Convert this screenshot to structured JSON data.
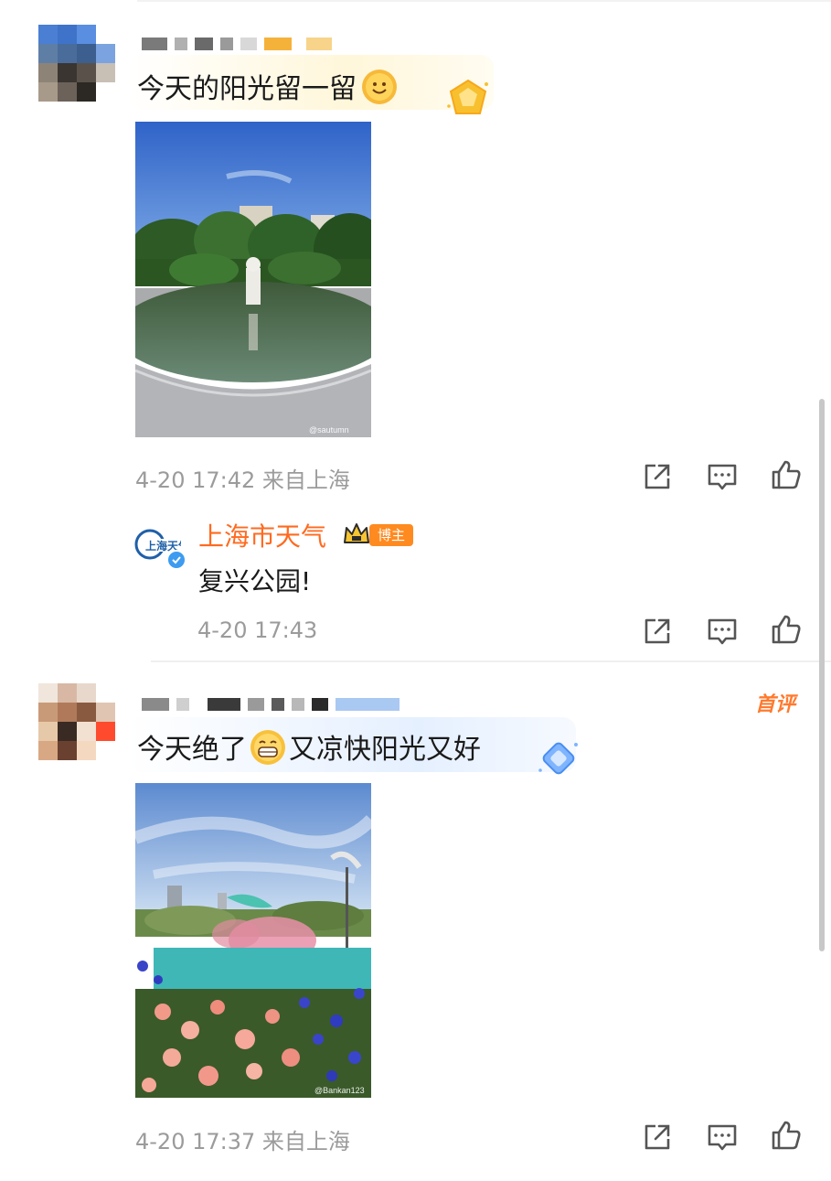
{
  "comments": [
    {
      "text": "今天的阳光留一留",
      "meta": "4-20 17:42 来自上海",
      "photo_watermark": "@sautumn",
      "reply": {
        "author": "上海市天气",
        "role_badge": "博主",
        "avatar_text": "上海天气",
        "text": "复兴公园!",
        "meta": "4-20 17:43"
      }
    },
    {
      "text_before": "今天绝了",
      "text_after": "又凉快阳光又好",
      "badge": "首评",
      "meta": "4-20 17:37 来自上海",
      "photo_watermark": "@Bankan123"
    }
  ],
  "icons": [
    "share-icon",
    "comment-icon",
    "like-icon",
    "sun-smile-emoji-icon",
    "grin-emoji-icon",
    "verified-icon",
    "crown-icon"
  ],
  "colors": {
    "accent": "#ff6a1f",
    "meta_text": "#9b9b9b",
    "body_text": "#1a1a1a"
  }
}
